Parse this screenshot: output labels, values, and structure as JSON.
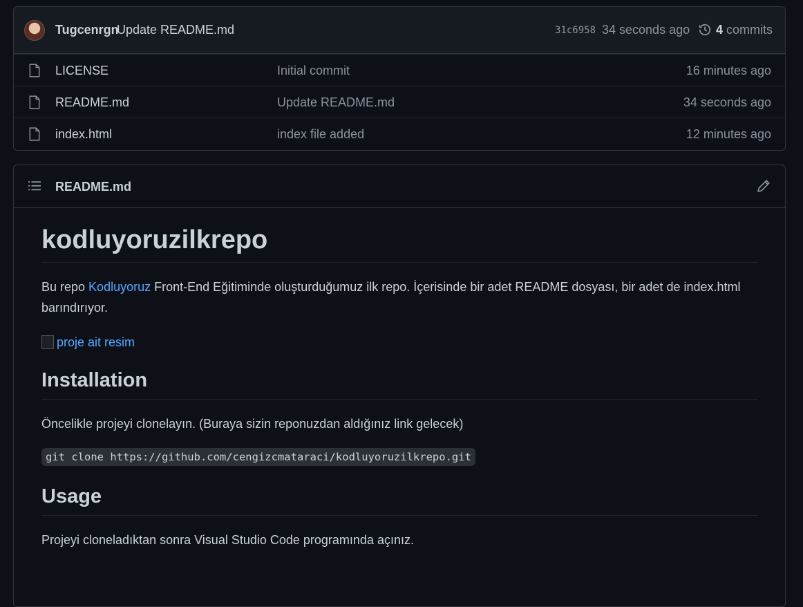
{
  "commit": {
    "author": "Tugcenrgn",
    "message": "Update README.md",
    "sha": "31c6958",
    "time": "34 seconds ago",
    "commits_count": "4",
    "commits_label": "commits"
  },
  "files": [
    {
      "name": "LICENSE",
      "commit": "Initial commit",
      "age": "16 minutes ago"
    },
    {
      "name": "README.md",
      "commit": "Update README.md",
      "age": "34 seconds ago"
    },
    {
      "name": "index.html",
      "commit": "index file added",
      "age": "12 minutes ago"
    }
  ],
  "readme": {
    "header_title": "README.md",
    "h1": "kodluyoruzilkrepo",
    "intro_before": "Bu repo ",
    "intro_link": "Kodluyoruz",
    "intro_after": " Front-End Eğitiminde oluşturduğumuz ilk repo. İçerisinde bir adet README dosyası, bir adet de index.html barındırıyor.",
    "image_alt": "proje ait resim",
    "installation_heading": "Installation",
    "installation_text": "Öncelikle projeyi clonelayın. (Buraya sizin reponuzdan aldığınız link gelecek)",
    "clone_command": "git clone https://github.com/cengizcmataraci/kodluyoruzilkrepo.git",
    "usage_heading": "Usage",
    "usage_text": "Projeyi cloneladıktan sonra Visual Studio Code programında açınız."
  },
  "colors": {
    "background": "#0d1117",
    "border": "#30363d",
    "text": "#c9d1d9",
    "muted": "#8b949e",
    "link": "#58a6ff"
  }
}
